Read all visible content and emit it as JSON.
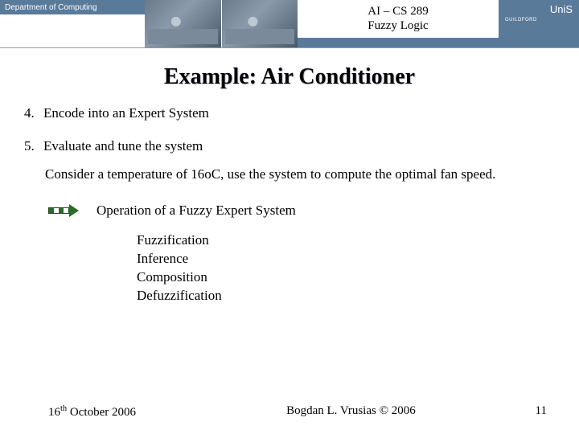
{
  "header": {
    "department": "Department of Computing",
    "course_line1": "AI – CS 289",
    "course_line2": "Fuzzy Logic",
    "logo_text": "UniS",
    "logo_sub": "GUILDFORD"
  },
  "title": "Example: Air Conditioner",
  "items": {
    "n4": "4.",
    "t4": "Encode into an Expert System",
    "n5": "5.",
    "t5": "Evaluate and tune the system"
  },
  "consider": "Consider a temperature of 16oC, use the system to compute the optimal fan speed.",
  "operation_heading": "Operation of a Fuzzy Expert System",
  "steps": {
    "s1": "Fuzzification",
    "s2": "Inference",
    "s3": "Composition",
    "s4": "Defuzzification"
  },
  "footer": {
    "date_pre": "16",
    "date_sup": "th",
    "date_post": " October 2006",
    "author": "Bogdan L. Vrusias © 2006",
    "page": "11"
  }
}
